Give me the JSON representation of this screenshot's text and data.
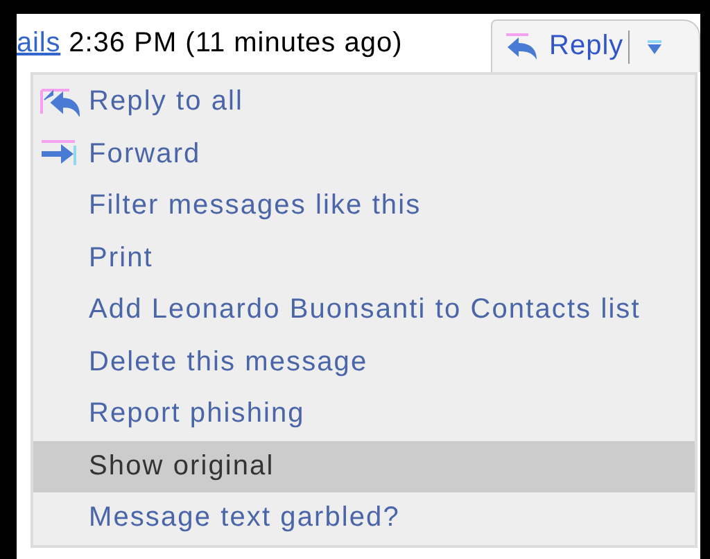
{
  "header": {
    "link": "ails",
    "time": "2:36 PM (11 minutes ago)",
    "reply_button": "Reply"
  },
  "menu": {
    "items": [
      {
        "label": "Reply to all",
        "kind": "replyall",
        "selected": false
      },
      {
        "label": "Forward",
        "kind": "forward",
        "selected": false
      },
      {
        "label": "Filter messages like this",
        "kind": "plain",
        "selected": false
      },
      {
        "label": "Print",
        "kind": "plain",
        "selected": false
      },
      {
        "label": "Add Leonardo Buonsanti to Contacts list",
        "kind": "plain",
        "selected": false
      },
      {
        "label": "Delete this message",
        "kind": "plain",
        "selected": false
      },
      {
        "label": "Report phishing",
        "kind": "plain",
        "selected": false
      },
      {
        "label": "Show original",
        "kind": "plain",
        "selected": true
      },
      {
        "label": "Message text garbled?",
        "kind": "plain",
        "selected": false
      }
    ]
  }
}
